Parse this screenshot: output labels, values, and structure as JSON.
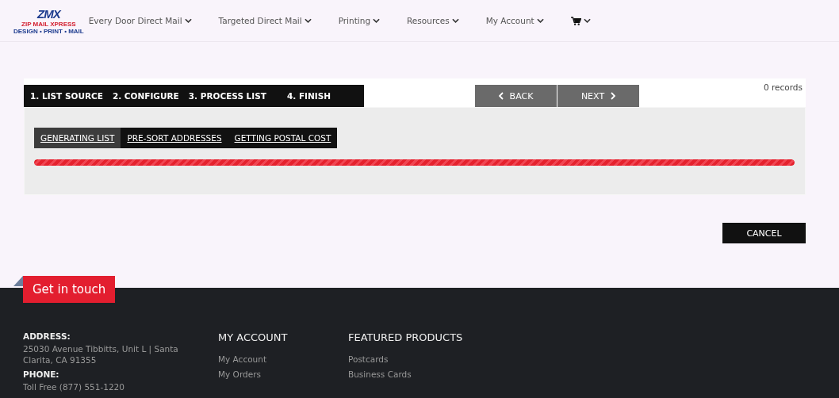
{
  "logo": {
    "mark": "ZMX",
    "tagline": "ZIP MAIL XPRESS",
    "motto": "DESIGN • PRINT • MAIL"
  },
  "nav": [
    {
      "label": "Every Door Direct Mail",
      "kind": "menu"
    },
    {
      "label": "Targeted Direct Mail",
      "kind": "menu"
    },
    {
      "label": "Printing",
      "kind": "menu"
    },
    {
      "label": "Resources",
      "kind": "menu"
    },
    {
      "label": "My Account",
      "kind": "menu"
    },
    {
      "kind": "cart"
    }
  ],
  "steps": [
    {
      "label": "1. LIST SOURCE",
      "selected": false
    },
    {
      "label": "2. CONFIGURE",
      "selected": false
    },
    {
      "label": "3. PROCESS LIST",
      "selected": false
    },
    {
      "label": "4. FINISH",
      "selected": false
    }
  ],
  "back_button": "BACK",
  "next_button": "NEXT",
  "records": "0 records",
  "subtabs": [
    {
      "label": "GENERATING LIST",
      "selected": true
    },
    {
      "label": "PRE-SORT ADDRESSES",
      "selected": false
    },
    {
      "label": "GETTING POSTAL COST",
      "selected": false
    }
  ],
  "progress": {
    "level": 1
  },
  "cancel_button": "CANCEL",
  "footer": {
    "badge": "Get in touch",
    "contact": [
      {
        "label": "ADDRESS:",
        "text": "25030 Avenue Tibbitts, Unit L | Santa Clarita, CA 91355"
      },
      {
        "label": "PHONE:",
        "text": "Toll Free (877) 551-1220"
      }
    ],
    "columns": [
      {
        "title": "MY ACCOUNT",
        "links": [
          "My Account",
          "My Orders"
        ]
      },
      {
        "title": "FEATURED PRODUCTS",
        "links": [
          "Postcards",
          "Business Cards"
        ]
      }
    ]
  }
}
